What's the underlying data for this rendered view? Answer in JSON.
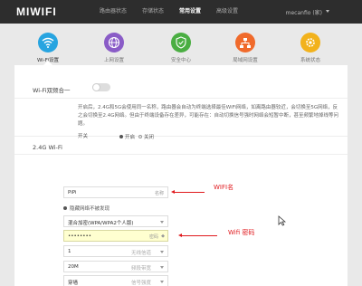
{
  "header": {
    "logo": "MIWIFI",
    "nav": [
      "路由器状态",
      "存储状态",
      "常用设置",
      "高级设置"
    ],
    "user": "mecanfio (家)"
  },
  "tabs": [
    {
      "label": "Wi-Fi设置",
      "icon": "wifi-icon",
      "color": "#27a4e0",
      "selected": true
    },
    {
      "label": "上网设置",
      "icon": "globe-icon",
      "color": "#8a5cc7",
      "selected": false
    },
    {
      "label": "安全中心",
      "icon": "shield-icon",
      "color": "#4aae42",
      "selected": false
    },
    {
      "label": "局域网设置",
      "icon": "network-icon",
      "color": "#f06a2b",
      "selected": false
    },
    {
      "label": "系统状态",
      "icon": "gear-icon",
      "color": "#f2b21c",
      "selected": false
    }
  ],
  "dualband": {
    "label": "Wi-Fi双频合一",
    "enabled": false,
    "description": "开启后，2.4G和5G会使用同一名称，路由器会自动为终端选择最佳WiFi网络，如离路由器较近，会切换至5G网络，反之会切换至2.4G网络。但由于终端设备存在差异，可能存在：自动切换信号强时网络会短暂中断，甚至频繁地掉线等问题。"
  },
  "wifi24": {
    "section_title": "2.4G Wi-Fi",
    "switch_label": "开关",
    "on_label": "开启",
    "off_label": "关闭",
    "ssid_value": "PiPi",
    "ssid_hint": "名称",
    "hidden_label": "隐藏网络不被发现",
    "encryption_value": "混合加密(WPA/WPA2个人版)",
    "password_value": "••••••••",
    "password_hint": "密码",
    "channel_value": "1",
    "channel_hint": "无线信道",
    "bandwidth_value": "20M",
    "bandwidth_hint": "频段带宽",
    "power_value": "穿墙",
    "power_hint": "信号强度"
  },
  "annotations": {
    "name_note": "WIFI名",
    "password_note": "Wifi 密码"
  },
  "colors": {
    "annotation": "#e0191d",
    "topbar": "#2d2d2d"
  }
}
